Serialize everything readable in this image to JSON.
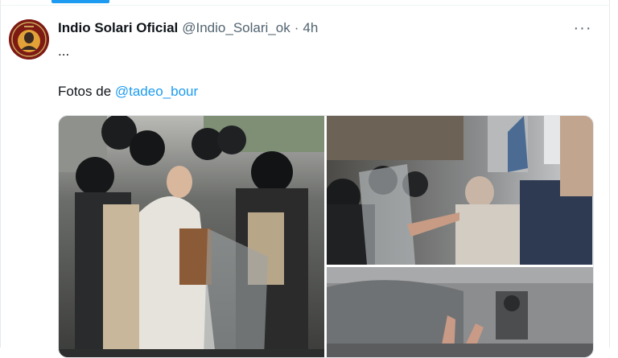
{
  "post": {
    "author": {
      "display_name": "Indio Solari Oficial",
      "handle": "@Indio_Solari_ok",
      "avatar_icon": "circular-portrait-avatar"
    },
    "separator": "·",
    "timestamp": "4h",
    "more_label": "···",
    "text_line_1": "...",
    "caption": {
      "prefix": "Fotos de ",
      "mention": "@tadeo_bour"
    },
    "media": [
      {
        "name": "photo-riot-police-1"
      },
      {
        "name": "photo-crowd-shields-2"
      },
      {
        "name": "photo-shield-closeup-3"
      }
    ]
  },
  "colors": {
    "accent": "#1d9bf0",
    "text_primary": "#0f1419",
    "text_secondary": "#536471",
    "avatar_bg": "#8a1c17"
  }
}
